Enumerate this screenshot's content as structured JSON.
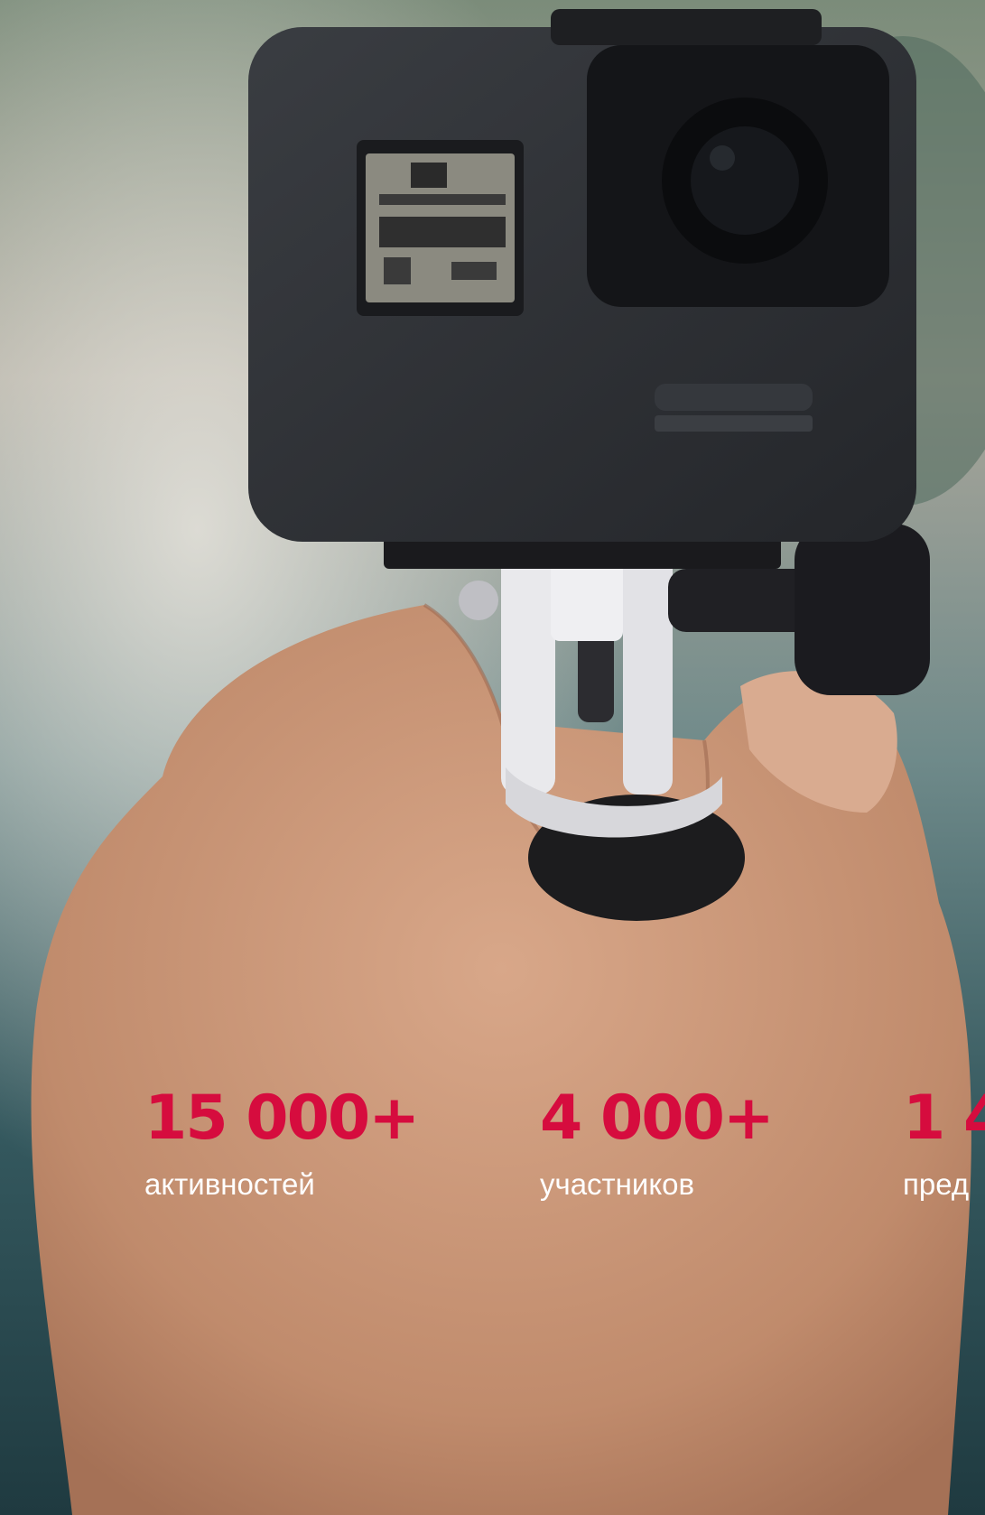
{
  "stats": [
    {
      "value": "15 000+",
      "label": "активностей"
    },
    {
      "value": "4 000+",
      "label": "участников"
    },
    {
      "value": "1 4",
      "label": "пред"
    }
  ],
  "colors": {
    "accent": "#d60c3e",
    "label": "#ffffff"
  }
}
